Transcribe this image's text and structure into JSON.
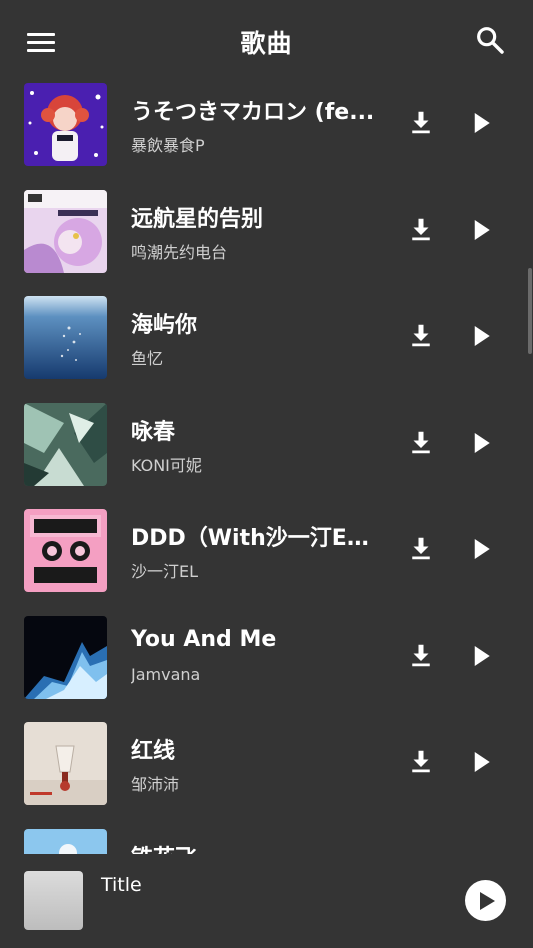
{
  "appbar": {
    "title": "歌曲",
    "menu_icon": "menu-icon",
    "search_icon": "search-icon"
  },
  "songs": [
    {
      "title": "うそつきマカロン (fe...",
      "artist": "暴飲暴食P",
      "cover": "purple-anime"
    },
    {
      "title": "远航星的告别",
      "artist": "鸣潮先约电台",
      "cover": "pink-anime"
    },
    {
      "title": "海屿你",
      "artist": "鱼忆",
      "cover": "ocean"
    },
    {
      "title": "咏春",
      "artist": "KONI可妮",
      "cover": "green-abstract"
    },
    {
      "title": "DDD（With沙一汀EL）",
      "artist": "沙一汀EL",
      "cover": "pink-down"
    },
    {
      "title": "You And Me",
      "artist": "Jamvana",
      "cover": "blue-wave"
    },
    {
      "title": "红线",
      "artist": "邹沛沛",
      "cover": "red-glass"
    },
    {
      "title": "铁花飞",
      "artist": "",
      "cover": "sky"
    }
  ],
  "icons": {
    "download": "download-icon",
    "play": "play-icon"
  },
  "player": {
    "title": "Title",
    "play_icon": "play-circle-icon"
  },
  "colors": {
    "background": "#343434",
    "text": "#ffffff",
    "subtext": "#cfcfcf"
  }
}
